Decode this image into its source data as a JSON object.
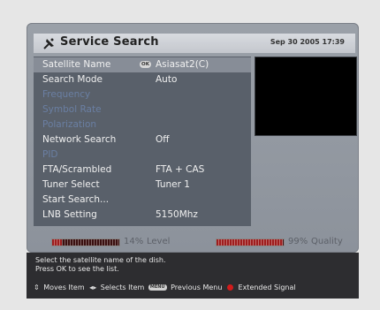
{
  "header": {
    "title": "Service Search",
    "datetime": "Sep 30 2005 17:39"
  },
  "menu": {
    "items": [
      {
        "label": "Satellite Name",
        "value": "Asiasat2(C)",
        "badge": "OK",
        "state": "selected"
      },
      {
        "label": "Search Mode",
        "value": "Auto",
        "state": "normal"
      },
      {
        "label": "Frequency",
        "value": "",
        "state": "disabled"
      },
      {
        "label": "Symbol Rate",
        "value": "",
        "state": "disabled"
      },
      {
        "label": "Polarization",
        "value": "",
        "state": "disabled"
      },
      {
        "label": "Network Search",
        "value": "Off",
        "state": "normal"
      },
      {
        "label": "PID",
        "value": "",
        "state": "disabled"
      },
      {
        "label": "FTA/Scrambled",
        "value": "FTA + CAS",
        "state": "normal"
      },
      {
        "label": "Tuner Select",
        "value": "Tuner 1",
        "state": "normal"
      },
      {
        "label": "Start Search...",
        "value": "",
        "state": "normal"
      },
      {
        "label": "LNB Setting",
        "value": "5150Mhz",
        "state": "normal"
      }
    ]
  },
  "meters": {
    "level": {
      "percent_text": "14%",
      "label": "Level",
      "fraction": 0.14
    },
    "quality": {
      "percent_text": "99%",
      "label": "Quality",
      "fraction": 0.99
    }
  },
  "footer": {
    "help_line1": "Select the satellite name of the dish.",
    "help_line2": "Press OK to see the list.",
    "legend": {
      "moves": "Moves Item",
      "selects": "Selects Item",
      "menu_key": "MENU",
      "previous": "Previous Menu",
      "extended": "Extended Signal"
    }
  },
  "colors": {
    "accent_red": "#d21b1b",
    "menu_bg": "#59606a",
    "selected_bg": "#878d97",
    "disabled_text": "#6a7fa3"
  }
}
